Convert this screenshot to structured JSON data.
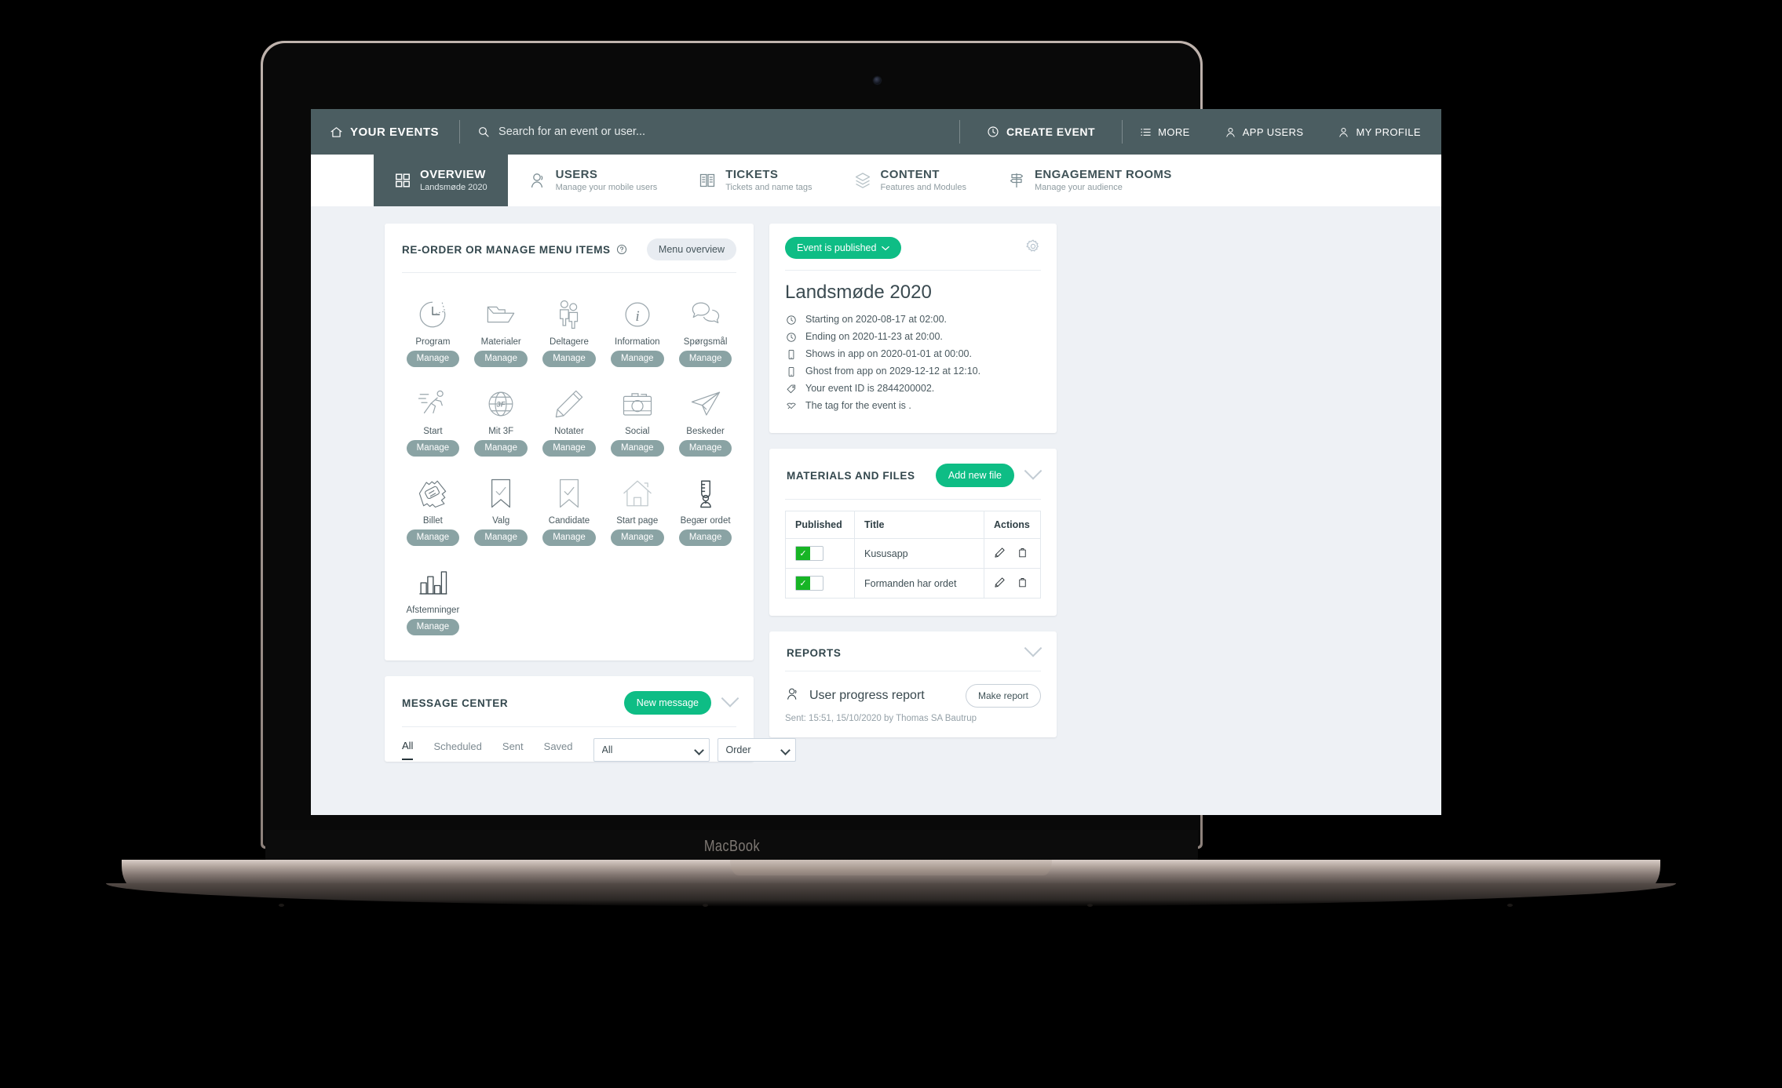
{
  "device": {
    "label": "MacBook"
  },
  "topnav": {
    "home": "YOUR EVENTS",
    "search_placeholder": "Search for an event or user...",
    "create_event": "CREATE EVENT",
    "more": "MORE",
    "app_users": "APP USERS",
    "my_profile": "MY PROFILE"
  },
  "tabs": [
    {
      "title": "OVERVIEW",
      "sub": "Landsmøde 2020",
      "active": true
    },
    {
      "title": "USERS",
      "sub": "Manage your mobile users",
      "active": false
    },
    {
      "title": "TICKETS",
      "sub": "Tickets and name tags",
      "active": false
    },
    {
      "title": "CONTENT",
      "sub": "Features and Modules",
      "active": false
    },
    {
      "title": "ENGAGEMENT ROOMS",
      "sub": "Manage your audience",
      "active": false
    }
  ],
  "menu_panel": {
    "title": "RE-ORDER OR MANAGE MENU ITEMS",
    "overview_button": "Menu overview",
    "manage_label": "Manage",
    "items": [
      {
        "label": "Program",
        "icon": "clock-arrow-icon"
      },
      {
        "label": "Materialer",
        "icon": "folder-icon"
      },
      {
        "label": "Deltagere",
        "icon": "people-icon"
      },
      {
        "label": "Information",
        "icon": "info-circle-icon"
      },
      {
        "label": "Spørgsmål",
        "icon": "speech-bubbles-icon"
      },
      {
        "label": "Start",
        "icon": "runner-icon"
      },
      {
        "label": "Mit 3F",
        "icon": "globe-3f-icon"
      },
      {
        "label": "Notater",
        "icon": "pencil-icon"
      },
      {
        "label": "Social",
        "icon": "camera-icon"
      },
      {
        "label": "Beskeder",
        "icon": "paper-plane-icon"
      },
      {
        "label": "Billet",
        "icon": "ticket-icon"
      },
      {
        "label": "Valg",
        "icon": "ribbon-check-icon"
      },
      {
        "label": "Candidate",
        "icon": "ribbon-check-icon"
      },
      {
        "label": "Start page",
        "icon": "house-icon"
      },
      {
        "label": "Begær ordet",
        "icon": "microphone-icon"
      },
      {
        "label": "Afstemninger",
        "icon": "bar-chart-icon"
      }
    ]
  },
  "event": {
    "status_badge": "Event is published",
    "title": "Landsmøde 2020",
    "lines": [
      {
        "icon": "clock-icon",
        "text": "Starting on 2020-08-17 at 02:00."
      },
      {
        "icon": "clock-icon",
        "text": "Ending on 2020-11-23 at 20:00."
      },
      {
        "icon": "phone-icon",
        "text": "Shows in app on 2020-01-01 at 00:00."
      },
      {
        "icon": "phone-icon",
        "text": "Ghost from app on 2029-12-12 at 12:10."
      },
      {
        "icon": "tag-icon",
        "text": "Your event ID is 2844200002."
      },
      {
        "icon": "label-icon",
        "text": "The tag for the event is ."
      }
    ]
  },
  "materials": {
    "title": "MATERIALS AND FILES",
    "add_button": "Add new file",
    "columns": [
      "Published",
      "Title",
      "Actions"
    ],
    "rows": [
      {
        "published": true,
        "title": "Kususapp"
      },
      {
        "published": true,
        "title": "Formanden har ordet"
      }
    ]
  },
  "reports": {
    "title": "REPORTS",
    "name": "User progress report",
    "make_button": "Make report",
    "sent": "Sent: 15:51, 15/10/2020 by Thomas SA Bautrup"
  },
  "message_center": {
    "title": "MESSAGE CENTER",
    "new_button": "New message",
    "tabs": [
      "All",
      "Scheduled",
      "Sent",
      "Saved"
    ],
    "filter_value": "All",
    "order_value": "Order"
  },
  "colors": {
    "nav": "#4b5d61",
    "accent_green": "#0ebd85",
    "toggle_green": "#17b525",
    "manage": "#8aa3a4",
    "page_bg": "#eef1f5"
  }
}
